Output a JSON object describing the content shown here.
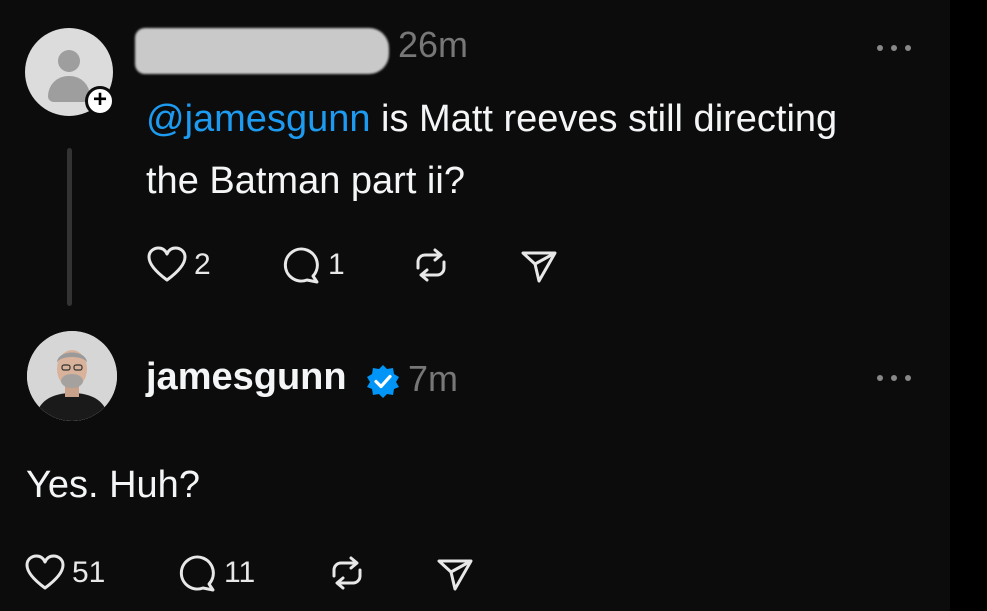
{
  "post1": {
    "time": "26m",
    "follow_symbol": "+",
    "mention": "@jamesgunn",
    "text": " is Matt reeves still directing the Batman part ii?",
    "likes": "2",
    "replies": "1",
    "icons": [
      "user-placeholder-icon",
      "heart-icon",
      "comment-icon",
      "repost-icon",
      "share-icon",
      "more-icon"
    ]
  },
  "post2": {
    "author": "jamesgunn",
    "time": "7m",
    "text": "Yes. Huh?",
    "likes": "51",
    "replies": "11",
    "icons": [
      "verified-badge-icon",
      "heart-icon",
      "comment-icon",
      "repost-icon",
      "share-icon",
      "more-icon"
    ]
  },
  "colors": {
    "background": "#0c0c0c",
    "text": "#f3f5f7",
    "muted": "#777777",
    "mention": "#1d9bf0",
    "verified": "#0095f6"
  }
}
